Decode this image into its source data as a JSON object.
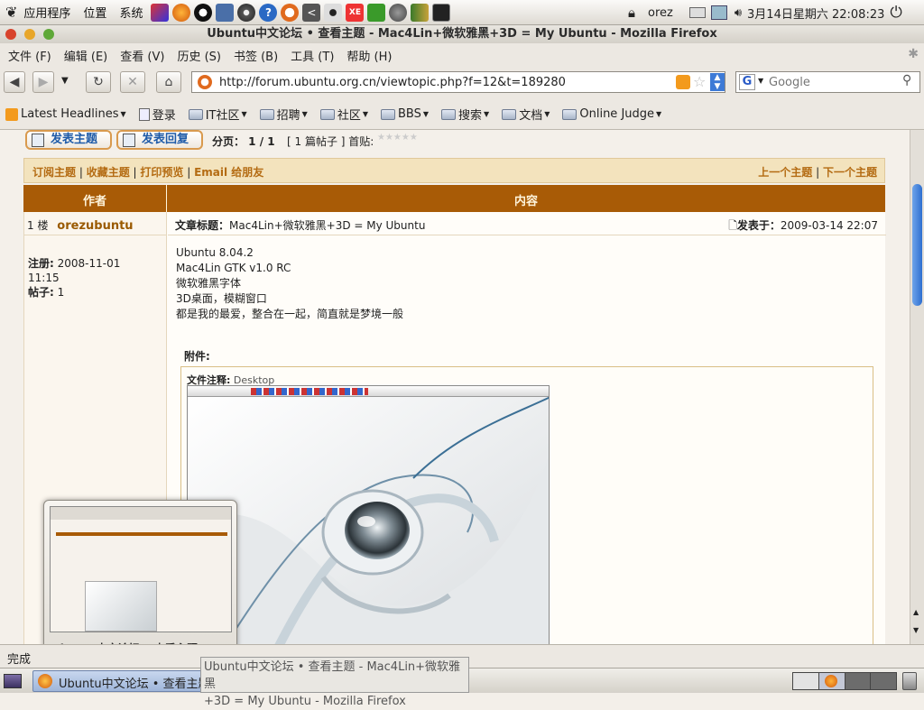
{
  "panel": {
    "applications": "应用程序",
    "places": "位置",
    "system": "系统",
    "user": "orez",
    "clock": "3月14日星期六 22:08:23"
  },
  "window": {
    "title": "Ubuntu中文论坛 • 查看主题 - Mac4Lin+微软雅黑+3D = My Ubuntu - Mozilla Firefox"
  },
  "menu": [
    "文件 (F)",
    "编辑 (E)",
    "查看 (V)",
    "历史 (S)",
    "书签 (B)",
    "工具 (T)",
    "帮助 (H)"
  ],
  "nav": {
    "url": "http://forum.ubuntu.org.cn/viewtopic.php?f=12&t=189280",
    "search_placeholder": "Google",
    "search_engine": "G"
  },
  "bookmarks": [
    "Latest Headlines",
    "登录",
    "IT社区",
    "招聘",
    "社区",
    "BBS",
    "搜索",
    "文档",
    "Online Judge"
  ],
  "forum": {
    "post_topic": "发表主题",
    "post_reply": "发表回复",
    "pagination": "分页： 1 / 1",
    "post_count": "[ 1 篇帖子 ] 首贴:",
    "links_left": [
      "订阅主题",
      "收藏主题",
      "打印预览",
      "Email 给朋友"
    ],
    "links_right": [
      "上一个主题",
      "下一个主题"
    ],
    "col_author": "作者",
    "col_content": "内容",
    "floor": "1 楼",
    "author": "orezubuntu",
    "subject_label": "文章标题：",
    "subject": "Mac4Lin+微软雅黑+3D = My Ubuntu",
    "posted_label": "发表于：",
    "posted": "2009-03-14 22:07",
    "reg_label": "注册:",
    "reg_date": "2008-11-01",
    "reg_time": "11:15",
    "posts_label": "帖子:",
    "posts_count": "1",
    "body": [
      "Ubuntu 8.04.2",
      "Mac4Lin GTK v1.0 RC",
      "微软雅黑字体",
      "3D桌面，模糊窗口",
      "都是我的最爱，整合在一起，简直就是梦境一般"
    ],
    "attachment_label": "附件:",
    "file_note_label": "文件注释:",
    "file_note": "Desktop"
  },
  "thumb": {
    "label": "Ubuntu中文论坛 • 查看主题 ..."
  },
  "status": {
    "text": "完成"
  },
  "taskbar": {
    "task": "Ubuntu中文论坛 • 查看主题",
    "tooltip_line1": "Ubuntu中文论坛 • 查看主题 - Mac4Lin+微软雅黑",
    "tooltip_line2": "+3D = My Ubuntu - Mozilla Firefox"
  },
  "colors": {
    "header_bg": "#a85b06",
    "link": "#b46b12",
    "linkbar_bg": "#f3e3bd",
    "author": "#9a5a00"
  }
}
